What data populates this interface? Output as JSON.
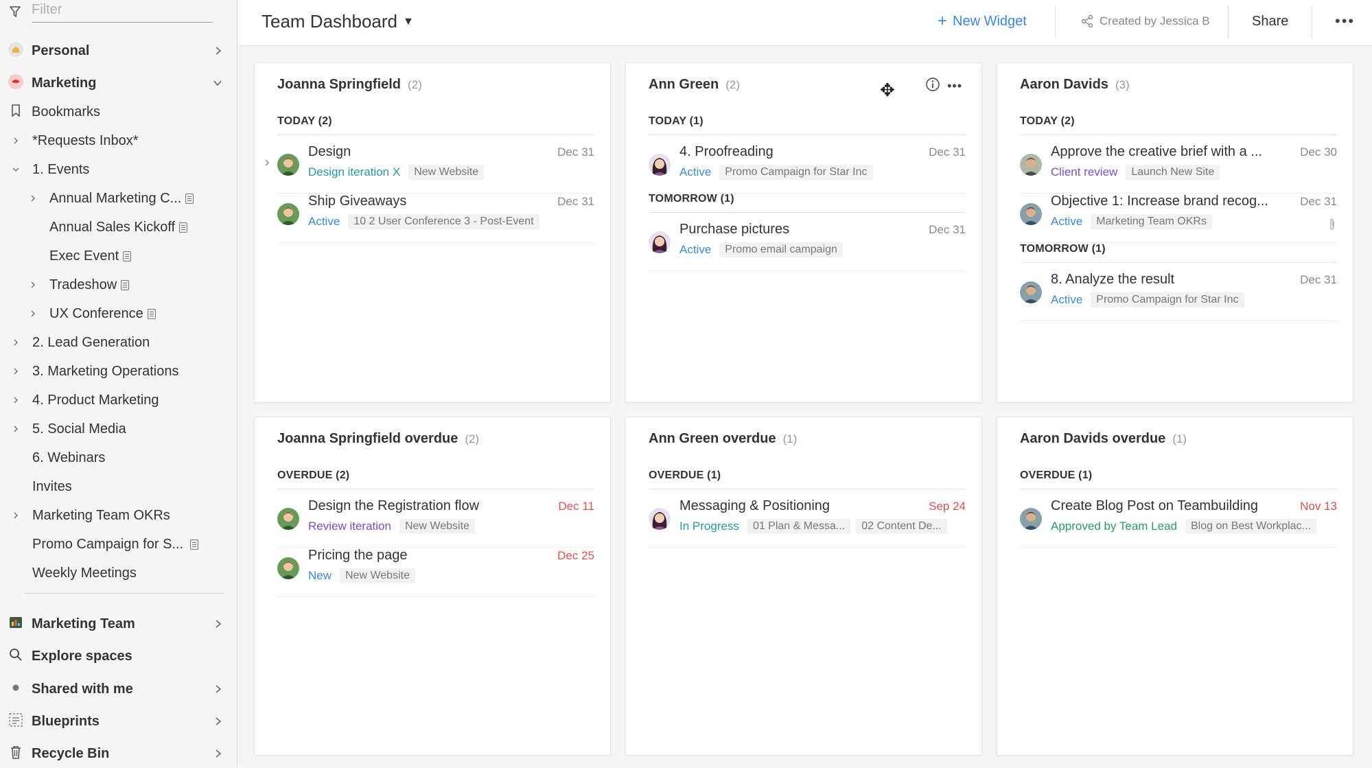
{
  "sidebar": {
    "filter_placeholder": "Filter",
    "personal": "Personal",
    "marketing": "Marketing",
    "bookmarks": "Bookmarks",
    "tree": [
      {
        "label": "*Requests Inbox*"
      },
      {
        "label": "1. Events"
      },
      {
        "label": "Annual Marketing C..."
      },
      {
        "label": "Annual Sales Kickoff"
      },
      {
        "label": "Exec Event"
      },
      {
        "label": "Tradeshow"
      },
      {
        "label": "UX Conference"
      },
      {
        "label": "2. Lead Generation"
      },
      {
        "label": "3. Marketing Operations"
      },
      {
        "label": "4. Product Marketing"
      },
      {
        "label": "5. Social Media"
      },
      {
        "label": "6. Webinars"
      },
      {
        "label": "Invites"
      },
      {
        "label": "Marketing Team OKRs"
      },
      {
        "label": "Promo Campaign for S..."
      },
      {
        "label": "Weekly Meetings"
      }
    ],
    "marketing_team": "Marketing Team",
    "explore_spaces": "Explore spaces",
    "shared_with_me": "Shared with me",
    "blueprints": "Blueprints",
    "recycle_bin": "Recycle Bin"
  },
  "topbar": {
    "title": "Team Dashboard",
    "new_widget": "New Widget",
    "created_by": "Created by Jessica B",
    "share": "Share"
  },
  "cards": [
    {
      "title": "Joanna Springfield",
      "count": "(2)",
      "sections": [
        {
          "label": "TODAY (2)",
          "tasks": [
            {
              "name": "Design",
              "date": "Dec 31",
              "status": "Design iteration X",
              "tags": [
                "New Website"
              ]
            },
            {
              "name": "Ship Giveaways",
              "date": "Dec 31",
              "status": "Active",
              "tags": [
                "10 2 User Conference 3 - Post-Event"
              ]
            }
          ]
        }
      ]
    },
    {
      "title": "Ann Green",
      "count": "(2)",
      "sections": [
        {
          "label": "TODAY (1)",
          "tasks": [
            {
              "name": "4. Proofreading",
              "date": "Dec 31",
              "status": "Active",
              "tags": [
                "Promo Campaign for Star Inc"
              ]
            }
          ]
        },
        {
          "label": "TOMORROW (1)",
          "tasks": [
            {
              "name": "Purchase pictures",
              "date": "Dec 31",
              "status": "Active",
              "tags": [
                "Promo email campaign"
              ]
            }
          ]
        }
      ]
    },
    {
      "title": "Aaron Davids",
      "count": "(3)",
      "sections": [
        {
          "label": "TODAY (2)",
          "tasks": [
            {
              "name": "Approve the creative brief with a ...",
              "date": "Dec 30",
              "status": "Client review",
              "tags": [
                "Launch New Site"
              ]
            },
            {
              "name": "Objective 1: Increase brand recog...",
              "date": "Dec 31",
              "status": "Active",
              "tags": [
                "Marketing Team OKRs"
              ]
            }
          ]
        },
        {
          "label": "TOMORROW (1)",
          "tasks": [
            {
              "name": "8. Analyze the result",
              "date": "Dec 31",
              "status": "Active",
              "tags": [
                "Promo Campaign for Star Inc"
              ]
            }
          ]
        }
      ]
    },
    {
      "title": "Joanna Springfield overdue",
      "count": "(2)",
      "sections": [
        {
          "label": "OVERDUE (2)",
          "tasks": [
            {
              "name": "Design the Registration flow",
              "date": "Dec 11",
              "status": "Review iteration",
              "tags": [
                "New Website"
              ]
            },
            {
              "name": "Pricing the page",
              "date": "Dec 25",
              "status": "New",
              "tags": [
                "New Website"
              ]
            }
          ]
        }
      ]
    },
    {
      "title": "Ann Green overdue",
      "count": "(1)",
      "sections": [
        {
          "label": "OVERDUE (1)",
          "tasks": [
            {
              "name": "Messaging & Positioning",
              "date": "Sep 24",
              "status": "In Progress",
              "tags": [
                "01 Plan & Messa...",
                "02 Content De..."
              ]
            }
          ]
        }
      ]
    },
    {
      "title": "Aaron Davids overdue",
      "count": "(1)",
      "sections": [
        {
          "label": "OVERDUE (1)",
          "tasks": [
            {
              "name": "Create Blog Post on Teambuilding",
              "date": "Nov 13",
              "status": "Approved by Team Lead",
              "tags": [
                "Blog on Best Workplac..."
              ]
            }
          ]
        }
      ]
    }
  ]
}
